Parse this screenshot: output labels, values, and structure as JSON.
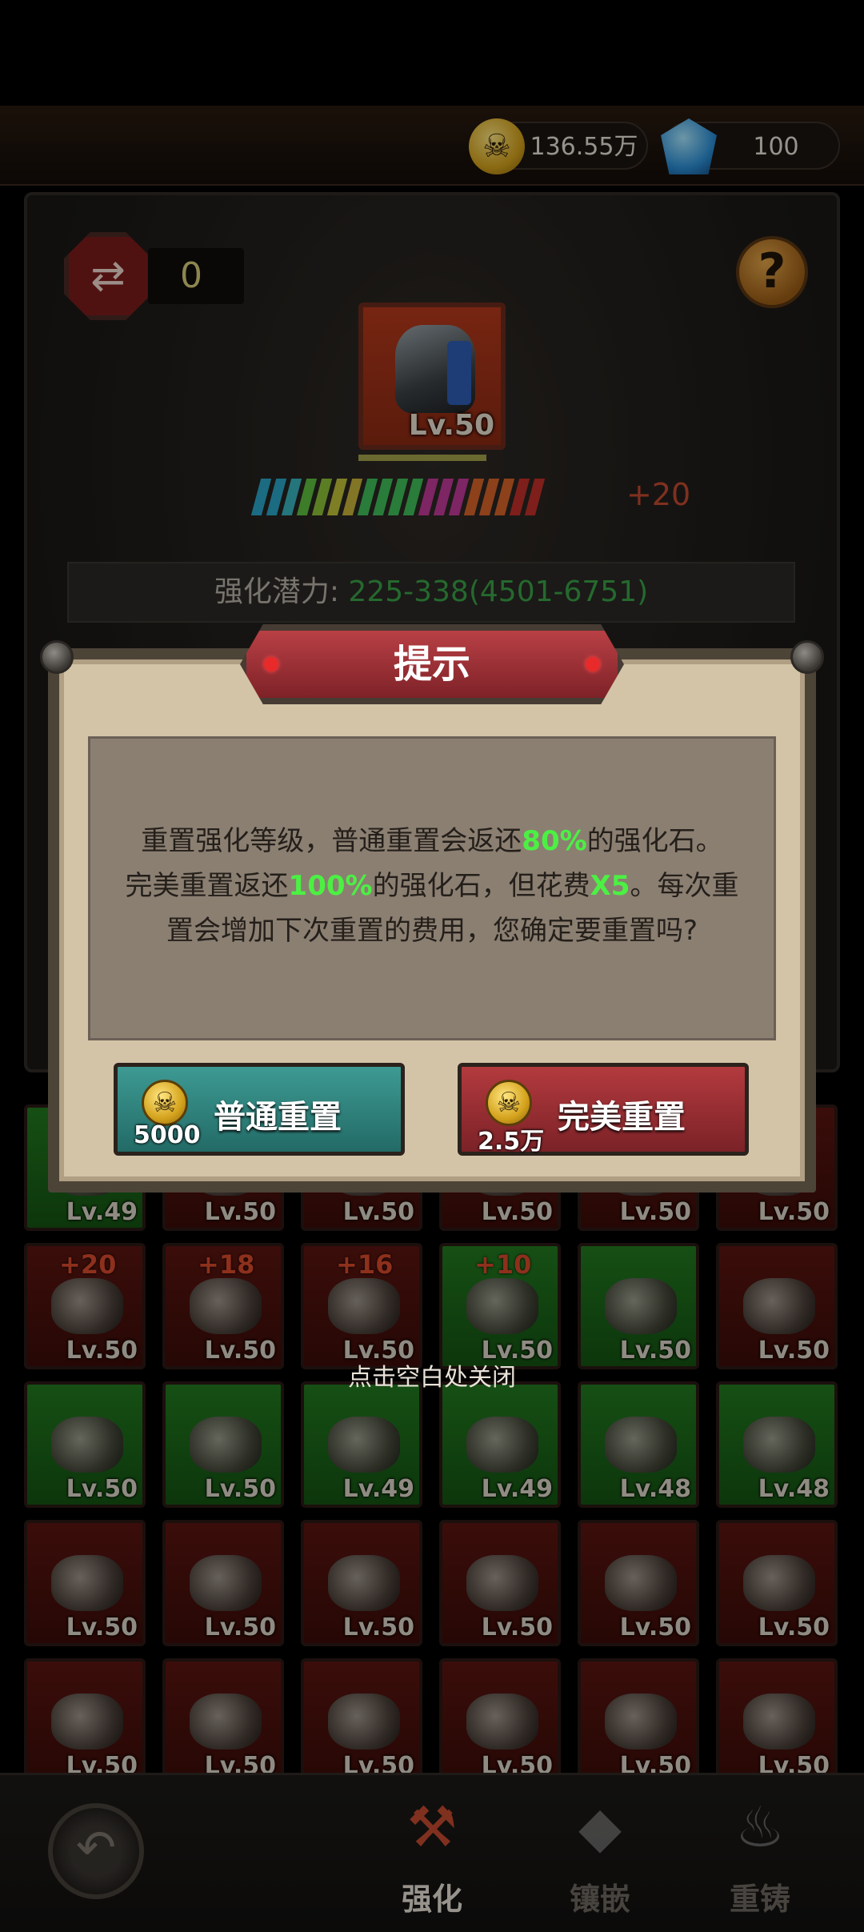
{
  "topbar": {
    "gold_amount": "136.55万",
    "gem_amount": "100",
    "gold_icon": "skull-coin-icon",
    "gem_icon": "blue-gem-icon"
  },
  "forge": {
    "reset_count": "0",
    "equipment_level": "Lv.50",
    "enhance_bonus": "+20",
    "potential_label": "强化潜力:",
    "potential_value": "225-338(4501-6751)",
    "bar_colors": [
      "#2aa6c8",
      "#2aa6c8",
      "#3ab4c0",
      "#5fbf3f",
      "#8cc23a",
      "#c2c43a",
      "#c8b43a",
      "#3fbf5a",
      "#3fbf5a",
      "#3fbf5a",
      "#3fbf5a",
      "#c23a9a",
      "#c23a9a",
      "#c23a9a",
      "#d8642a",
      "#d8642a",
      "#d8642a",
      "#c2302a",
      "#c2302a"
    ]
  },
  "dialog": {
    "title": "提示",
    "line1_a": "重置强化等级，普通重置会返还",
    "line1_hl": "80%",
    "line1_b": "的强化石。",
    "line2_a": "完美重置返还",
    "line2_hl1": "100%",
    "line2_b": "的强化石，但花费",
    "line2_hl2": "X5",
    "line2_c": "。每次重",
    "line3": "置会增加下次重置的费用，您确定要重置吗?",
    "normal_reset": {
      "label": "普通重置",
      "cost": "5000"
    },
    "perfect_reset": {
      "label": "完美重置",
      "cost": "2.5万"
    },
    "close_hint": "点击空白处关闭"
  },
  "inventory": [
    {
      "color": "green",
      "lv": "Lv.49",
      "plus": ""
    },
    {
      "color": "red",
      "lv": "Lv.50",
      "plus": ""
    },
    {
      "color": "red",
      "lv": "Lv.50",
      "plus": ""
    },
    {
      "color": "red",
      "lv": "Lv.50",
      "plus": ""
    },
    {
      "color": "red",
      "lv": "Lv.50",
      "plus": ""
    },
    {
      "color": "red",
      "lv": "Lv.50",
      "plus": ""
    },
    {
      "color": "red",
      "lv": "Lv.50",
      "plus": "+20"
    },
    {
      "color": "red",
      "lv": "Lv.50",
      "plus": "+18"
    },
    {
      "color": "red",
      "lv": "Lv.50",
      "plus": "+16"
    },
    {
      "color": "green",
      "lv": "Lv.50",
      "plus": "+10"
    },
    {
      "color": "green",
      "lv": "Lv.50",
      "plus": ""
    },
    {
      "color": "red",
      "lv": "Lv.50",
      "plus": ""
    },
    {
      "color": "green",
      "lv": "Lv.50",
      "plus": ""
    },
    {
      "color": "green",
      "lv": "Lv.50",
      "plus": ""
    },
    {
      "color": "green",
      "lv": "Lv.49",
      "plus": ""
    },
    {
      "color": "green",
      "lv": "Lv.49",
      "plus": ""
    },
    {
      "color": "green",
      "lv": "Lv.48",
      "plus": ""
    },
    {
      "color": "green",
      "lv": "Lv.48",
      "plus": ""
    },
    {
      "color": "red",
      "lv": "Lv.50",
      "plus": ""
    },
    {
      "color": "red",
      "lv": "Lv.50",
      "plus": ""
    },
    {
      "color": "red",
      "lv": "Lv.50",
      "plus": ""
    },
    {
      "color": "red",
      "lv": "Lv.50",
      "plus": ""
    },
    {
      "color": "red",
      "lv": "Lv.50",
      "plus": ""
    },
    {
      "color": "red",
      "lv": "Lv.50",
      "plus": ""
    },
    {
      "color": "red",
      "lv": "Lv.50",
      "plus": ""
    },
    {
      "color": "red",
      "lv": "Lv.50",
      "plus": ""
    },
    {
      "color": "red",
      "lv": "Lv.50",
      "plus": ""
    },
    {
      "color": "red",
      "lv": "Lv.50",
      "plus": ""
    },
    {
      "color": "red",
      "lv": "Lv.50",
      "plus": ""
    },
    {
      "color": "red",
      "lv": "Lv.50",
      "plus": ""
    }
  ],
  "nav": {
    "enhance": "强化",
    "inlay": "镶嵌",
    "recast": "重铸"
  }
}
